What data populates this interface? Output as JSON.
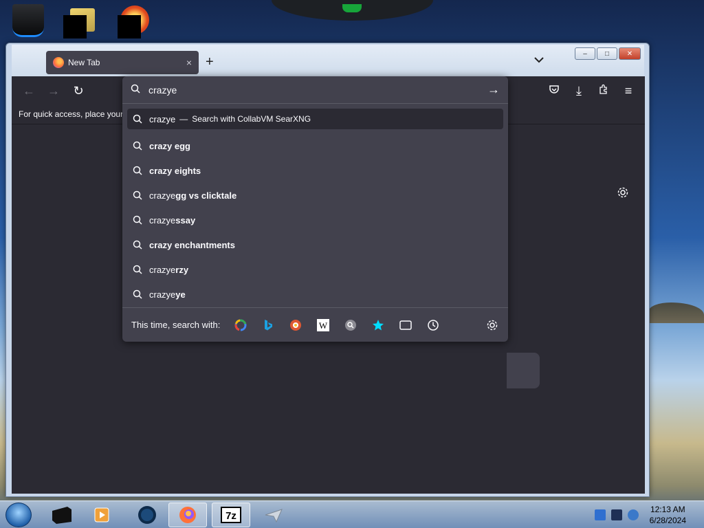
{
  "desktop": {
    "icons": [
      "recycle-bin-icon",
      "folder-icon",
      "app-icon"
    ]
  },
  "window": {
    "tab": {
      "title": "New Tab",
      "close": "×"
    },
    "new_tab": "+",
    "list_all_tabs": "⌄",
    "controls": {
      "minimize": "–",
      "maximize": "□",
      "close": "✕"
    }
  },
  "toolbar": {
    "back": "←",
    "forward": "→",
    "reload": "↻",
    "pocket": "pocket-icon",
    "downloads": "⤓",
    "extensions": "extensions-icon",
    "menu": "≡"
  },
  "bookmarks_bar": {
    "text": "For quick access, place your b"
  },
  "urlbar": {
    "value": "crazye",
    "go": "→",
    "heuristic": {
      "typed": "crazye",
      "separator": "—",
      "engine_text": "Search with CollabVM SearXNG"
    },
    "suggestions": [
      {
        "prefix": "",
        "rest": "crazy egg"
      },
      {
        "prefix": "",
        "rest": "crazy eights"
      },
      {
        "prefix": "crazye",
        "rest": "gg vs clicktale"
      },
      {
        "prefix": "crazye",
        "rest": "ssay"
      },
      {
        "prefix": "",
        "rest": "crazy enchantments"
      },
      {
        "prefix": "crazye",
        "rest": "rzy"
      },
      {
        "prefix": "crazye",
        "rest": "ye"
      }
    ],
    "oneoff_label": "This time, search with:",
    "engines": [
      "google-icon",
      "bing-icon",
      "duckduckgo-icon",
      "wikipedia-icon",
      "searx-icon",
      "bookmarks-icon",
      "tabs-icon",
      "history-icon",
      "search-settings-icon"
    ]
  },
  "taskbar": {
    "items": [
      "start-button",
      "explorer-icon",
      "media-player-icon",
      "firefox-icon-task",
      "7zip-icon",
      "paper-plane-icon"
    ],
    "clock": {
      "time": "12:13 AM",
      "date": "6/28/2024"
    }
  },
  "colors": {
    "browser_bg": "#2b2a33",
    "popup_bg": "#42414d",
    "text": "#fbfbfe"
  }
}
